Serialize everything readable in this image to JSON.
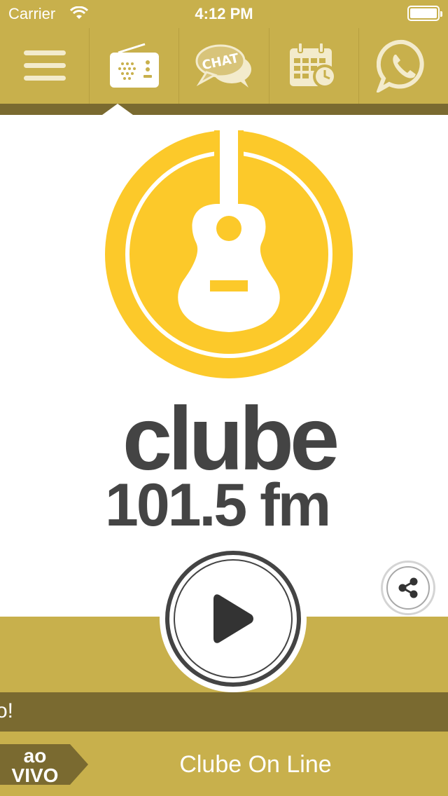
{
  "status_bar": {
    "carrier": "Carrier",
    "time": "4:12 PM"
  },
  "toolbar": {
    "items": [
      {
        "name": "menu",
        "icon": "hamburger-menu-icon"
      },
      {
        "name": "radio",
        "icon": "radio-icon",
        "active": true
      },
      {
        "name": "chat",
        "icon": "chat-bubble-icon",
        "label": "CHAT"
      },
      {
        "name": "schedule",
        "icon": "calendar-clock-icon"
      },
      {
        "name": "whatsapp",
        "icon": "whatsapp-icon"
      }
    ]
  },
  "logo": {
    "name": "clube",
    "frequency": "101.5 fm"
  },
  "player": {
    "play_icon": "play-icon",
    "share_icon": "share-icon"
  },
  "ticker": {
    "text": "o!"
  },
  "now_playing": {
    "badge_line1": "ao",
    "badge_line2": "VIVO",
    "station": "Clube On Line"
  },
  "colors": {
    "gold": "#c8b04c",
    "dark_gold": "#7a6a30",
    "logo_yellow": "#fcc92a",
    "logo_text": "#444444"
  }
}
